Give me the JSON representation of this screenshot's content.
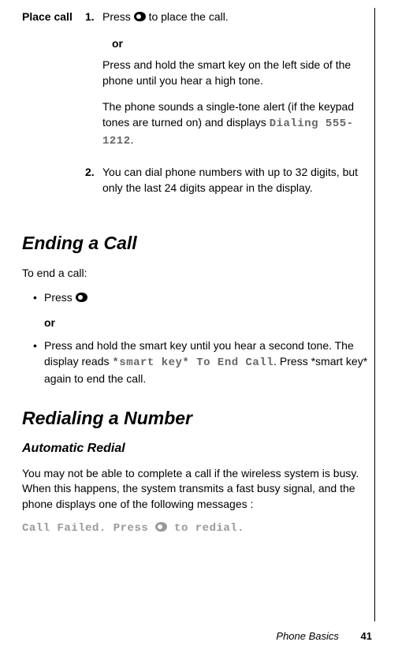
{
  "placeCall": {
    "label": "Place call",
    "steps": [
      {
        "num": "1.",
        "pre": "Press ",
        "post": " to place the call.",
        "or": "or",
        "para2": "Press and hold the smart key on the left side of the phone until you hear a high tone.",
        "para3a": "The phone sounds a single-tone alert (if the keypad tones are turned on) and displays ",
        "para3b": "Dialing 555-1212",
        "para3c": "."
      },
      {
        "num": "2.",
        "para": "You can dial phone numbers with up to 32 digits, but only the last 24 digits appear in the display."
      }
    ]
  },
  "ending": {
    "heading": "Ending a Call",
    "intro": "To end a call:",
    "bullet1_pre": "Press ",
    "or": "or",
    "bullet2a": "Press and hold the smart key until you hear a second tone. The display reads ",
    "bullet2b": "*smart key* To End Call",
    "bullet2c": ". Press *smart key* again to end the call."
  },
  "redial": {
    "heading": "Redialing a Number",
    "subheading": "Automatic Redial",
    "para": "You may not be able to complete a call if the wireless system is busy. When this happens, the system transmits a fast busy signal, and the phone displays one of the following messages :",
    "msg_a": "Call Failed",
    "msg_b": ". ",
    "msg_c": "Press ",
    "msg_d": " to redial",
    "msg_e": "."
  },
  "footer": {
    "section": "Phone Basics",
    "page": "41"
  }
}
